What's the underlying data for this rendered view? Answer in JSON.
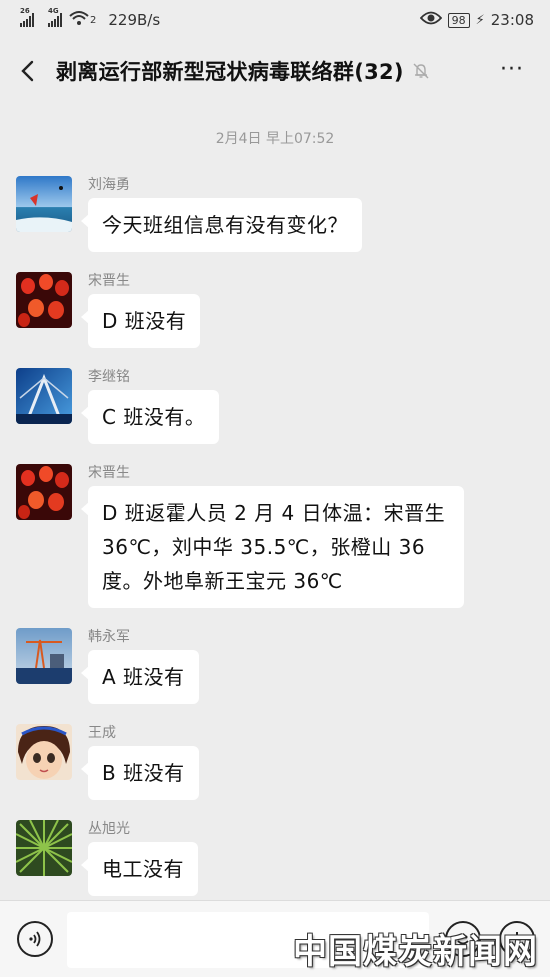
{
  "status_bar": {
    "net1": "26",
    "net2": "4G",
    "hotspot_count": "2",
    "speed": "229B/s",
    "battery": "98",
    "time": "23:08"
  },
  "header": {
    "title": "剥离运行部新型冠状病毒联络群(32)",
    "back_icon": "chevron-left-icon",
    "mute_icon": "bell-off-icon",
    "more_label": "···"
  },
  "chat": {
    "timestamp": "2月4日 早上07:52",
    "messages": [
      {
        "sender": "刘海勇",
        "text": "今天班组信息有没有变化？",
        "avatar": "sea-kitesurf"
      },
      {
        "sender": "宋晋生",
        "text": "D 班没有",
        "avatar": "red-lanterns"
      },
      {
        "sender": "李继铭",
        "text": "C 班没有。",
        "avatar": "blue-bridge"
      },
      {
        "sender": "宋晋生",
        "text": "D 班返霍人员 2 月 4 日体温：宋晋生 36℃，刘中华 35.5℃，张橙山 36 度。外地阜新王宝元 36℃",
        "avatar": "red-lanterns"
      },
      {
        "sender": "韩永军",
        "text": "A 班没有",
        "avatar": "crane-sky"
      },
      {
        "sender": "王成",
        "text": "B 班没有",
        "avatar": "cartoon-girl"
      },
      {
        "sender": "丛旭光",
        "text": "电工没有",
        "avatar": "green-plant"
      }
    ]
  },
  "input_bar": {
    "voice_icon": "voice-icon",
    "input_value": "",
    "emoji_icon": "emoji-icon",
    "plus_icon": "plus-icon"
  },
  "watermark": "中国煤炭新闻网",
  "colors": {
    "background": "#ededed",
    "bubble": "#ffffff",
    "sender": "#888888"
  }
}
